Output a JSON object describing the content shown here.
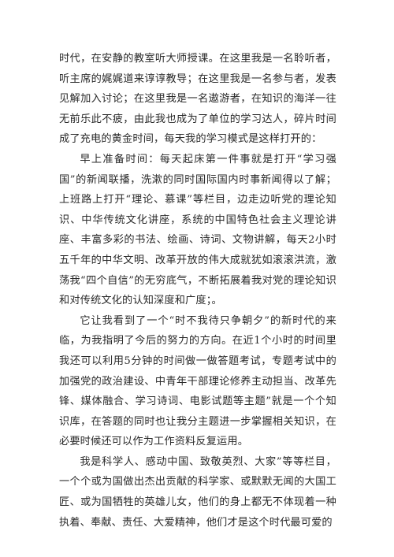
{
  "document": {
    "paragraphs": [
      {
        "indent": false,
        "text": "时代，在安静的教室听大师授课。在这里我是一名聆听者，听主席的娓娓道来谆谆教导；在这里我是一名参与者，发表见解加入讨论；在这里我是一名遨游者，在知识的海洋一往无前乐此不疲，由此我也成为了单位的学习达人，碎片时间成了充电的黄金时间，每天我的学习模式是这样打开的："
      },
      {
        "indent": true,
        "text": "早上准备时间：每天起床第一件事就是打开“学习强国”的新闻联播，洗漱的同时国际国内时事新闻得以了解；上班路上打开“理论、慕课”等栏目，边走边听党的理论知识、中华传统文化讲座，系统的中国特色社会主义理论讲座、丰富多彩的书法、绘画、诗词、文物讲解，每天2小时五千年的中华文明、改革开放的伟大成就犹如滚滚洪流，激荡我“四个自信”的无穷底气，不断拓展着我对党的理论知识和对传统文化的认知深度和广度；。"
      },
      {
        "indent": true,
        "text": "它让我看到了一个“时不我待只争朝夕”的新时代的来临，为我指明了今后的努力的方向。在近1个小时的时间里我还可以利用5分钟的时间做一做答题考试，专题考试中的加强党的政治建设、中青年干部理论修养主动担当、改革先锋、媒体融合、学习诗词、电影试题等主题”就是一个个知识库，在答题的同时也让我分主题进一步掌握相关知识，在必要时候还可以作为工作资料反复运用。"
      },
      {
        "indent": true,
        "text": "我是科学人、感动中国、致敬英烈、大家”等等栏目，一个个或为国做出杰出贡献的科学家、或默默无闻的大国工匠、或为国牺牲的英雄儿女，他们的身上都无不体现着一种执着、奉献、责任、大爱精神，他们才是这个时代最可爱的"
      }
    ]
  }
}
